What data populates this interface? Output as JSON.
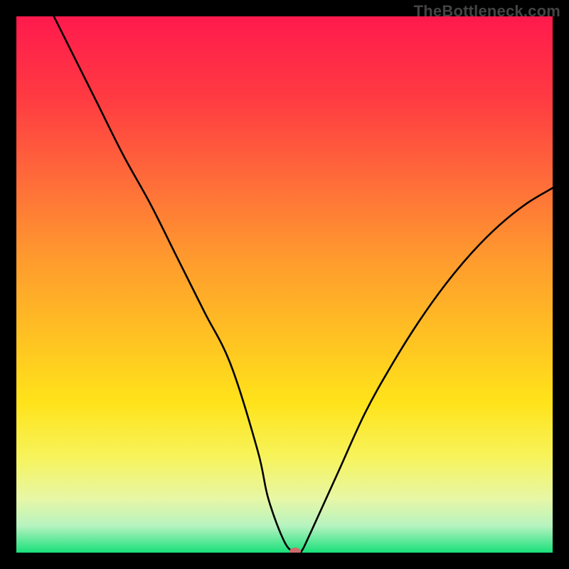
{
  "watermark": "TheBottleneck.com",
  "chart_data": {
    "type": "line",
    "title": "",
    "xlabel": "",
    "ylabel": "",
    "xlim": [
      0,
      100
    ],
    "ylim": [
      0,
      100
    ],
    "grid": false,
    "legend": false,
    "background": "rainbow-gradient-vertical",
    "series": [
      {
        "name": "bottleneck-curve",
        "color": "#000000",
        "x": [
          7,
          10,
          15,
          20,
          25,
          30,
          35,
          40,
          45,
          47,
          50,
          52,
          53,
          55,
          60,
          65,
          70,
          75,
          80,
          85,
          90,
          95,
          100
        ],
        "values": [
          100,
          94,
          84,
          74,
          65,
          55,
          45,
          35,
          19,
          10,
          2,
          0,
          0,
          4,
          15,
          26,
          35,
          43,
          50,
          56,
          61,
          65,
          68
        ]
      }
    ],
    "marker": {
      "x": 52,
      "y": 0,
      "color": "#d06a6a",
      "rx": 8,
      "ry": 5
    },
    "gradient_stops": [
      {
        "offset": 0.0,
        "color": "#ff1a4d"
      },
      {
        "offset": 0.15,
        "color": "#ff3a42"
      },
      {
        "offset": 0.3,
        "color": "#ff6a3a"
      },
      {
        "offset": 0.45,
        "color": "#ff9a2e"
      },
      {
        "offset": 0.6,
        "color": "#ffc222"
      },
      {
        "offset": 0.72,
        "color": "#ffe31a"
      },
      {
        "offset": 0.82,
        "color": "#f7f35a"
      },
      {
        "offset": 0.9,
        "color": "#e7f7a6"
      },
      {
        "offset": 0.95,
        "color": "#b7f3c0"
      },
      {
        "offset": 1.0,
        "color": "#18e07a"
      }
    ]
  }
}
